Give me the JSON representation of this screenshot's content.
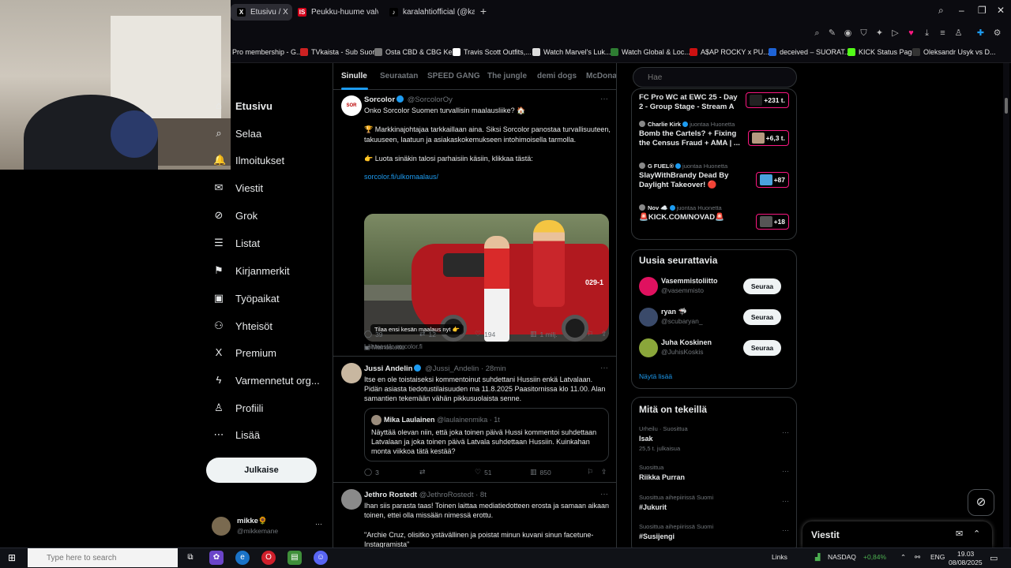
{
  "browser": {
    "tabs": [
      {
        "label": "Etusivu / X",
        "fav_color": "#000000",
        "fav": "X"
      },
      {
        "label": "Peukku-huume valvottaa",
        "fav_color": "#d0021b",
        "fav": "IS"
      },
      {
        "label": "karalahtiofficial (@karalahti...",
        "fav_color": "#000000",
        "fav": "♪"
      }
    ],
    "bookmarks": [
      {
        "label": "Pro membership - G...",
        "color": "#444444"
      },
      {
        "label": "TVkaista - Sub Suora",
        "color": "#cc2222"
      },
      {
        "label": "Osta CBD & CBG Ke...",
        "color": "#777777"
      },
      {
        "label": "Travis Scott Outfits,...",
        "color": "#ffffff"
      },
      {
        "label": "Watch Marvel's Luk...",
        "color": "#dddddd"
      },
      {
        "label": "Watch Global & Loc...",
        "color": "#2e7d32"
      },
      {
        "label": "A$AP ROCKY x PU...",
        "color": "#cc1111"
      },
      {
        "label": "deceived – SUORAT...",
        "color": "#1e63d6"
      },
      {
        "label": "KICK Status Page",
        "color": "#53fc18"
      },
      {
        "label": "Oleksandr Usyk vs D...",
        "color": "#333333"
      }
    ]
  },
  "nav": {
    "items": [
      {
        "label": "Etusivu",
        "icon": "⌂",
        "bold": true
      },
      {
        "label": "Selaa",
        "icon": "⌕"
      },
      {
        "label": "Ilmoitukset",
        "icon": "🔔"
      },
      {
        "label": "Viestit",
        "icon": "✉"
      },
      {
        "label": "Grok",
        "icon": "⊘"
      },
      {
        "label": "Listat",
        "icon": "☰"
      },
      {
        "label": "Kirjanmerkit",
        "icon": "⚑"
      },
      {
        "label": "Työpaikat",
        "icon": "▣"
      },
      {
        "label": "Yhteisöt",
        "icon": "⚇"
      },
      {
        "label": "Premium",
        "icon": "X"
      },
      {
        "label": "Varmennetut org...",
        "icon": "ϟ"
      },
      {
        "label": "Profiili",
        "icon": "♙"
      },
      {
        "label": "Lisää",
        "icon": "⋯"
      }
    ],
    "post_label": "Julkaise",
    "profile": {
      "name": "mikke🌻",
      "handle": "@mikkemane",
      "more": "···"
    }
  },
  "feed": {
    "tabs": [
      "Sinulle",
      "Seuraatan",
      "SPEED GANG",
      "The jungle",
      "demi dogs",
      "McDonal"
    ],
    "tweets": [
      {
        "name": "Sorcolor",
        "handle": "@SorcolorOy",
        "text": "Onko Sorcolor Suomen turvallisin maalausliike? 🏠\n\n🏆 Markkinajohtajaa tarkkaillaan aina. Siksi Sorcolor panostaa turvallisuuteen, takuuseen, laatuun ja asiakaskokemukseen intohimoisella tarmolla.\n\n👉 Luota sinäkin talosi parhaisiin käsiin, klikkaa tästä:",
        "link": "sorcolor.fi/ulkomaalaus/",
        "media_caption": "Tilaa ensi kesän maalaus nyt 👉",
        "media_plate": "029-1",
        "media_source": "Lähteestä: sorcolor.fi",
        "promoted": "Mainostettu",
        "replies": "39",
        "reposts": "12",
        "likes": "194",
        "views": "1 milj."
      },
      {
        "name": "Jussi Andelin",
        "handle": "@Jussi_Andelin · 28min",
        "text": "Itse en ole toistaiseksi kommentoinut suhdettani Hussiin enkä Latvalaan. Pidän asiasta tiedotustilaisuuden ma 11.8.2025 Paasitornissa klo 11.00. Alan samantien tekemään vähän pikkusuolaista senne.",
        "quote": {
          "name": "Mika Laulainen",
          "handle": "@laulainenmika · 1t",
          "text": "Näyttää olevan niin, että joka toinen päivä Hussi kommentoi suhdettaan Latvalaan ja joka toinen päivä Latvala suhdettaan Hussiin. Kuinkahan monta viikkoa tätä kestää?"
        },
        "replies": "3",
        "reposts": "",
        "likes": "51",
        "views": "850"
      },
      {
        "name": "Jethro Rostedt",
        "handle": "@JethroRostedt · 8t",
        "text": "Ihan siis parasta taas! Toinen laittaa mediatiedotteen erosta ja samaan aikaan toinen, ettei olla missään nimessä erottu.\n\n\"Archie Cruz, olisitko ystävällinen ja poistat minun kuvani sinun facetune-Instagramista\""
      }
    ]
  },
  "right": {
    "search_placeholder": "Hae",
    "live": [
      {
        "who": "",
        "suffix": "",
        "title": "FC Pro WC at EWC 25 - Day 2 - Group Stage - Stream A",
        "count": "+231 t.",
        "thumb": "#222222"
      },
      {
        "who": "Charlie Kirk",
        "suffix": "juontaa Huonetta",
        "title": "Bomb the Cartels? + Fixing the Census Fraud + AMA | ...",
        "count": "+6,3 t.",
        "thumb": "#b59a80"
      },
      {
        "who": "G FUEL®",
        "suffix": "juontaa Huonetta",
        "title": "SlayWithBrandy Dead By Daylight Takeover! 🔴",
        "count": "+87",
        "thumb": "#4aa3df"
      },
      {
        "who": "Nov ☁️",
        "suffix": "juontaa Huonetta",
        "title": "🚨KICK.COM/NOVAD🚨",
        "count": "+18",
        "thumb": "#555555"
      }
    ],
    "follow_title": "Uusia seurattavia",
    "follow": [
      {
        "name": "Vasemmistoliitto",
        "handle": "@vasemmisto",
        "btn": "Seuraa",
        "color": "#e0115f"
      },
      {
        "name": "ryan 🦈",
        "handle": "@scubaryan_",
        "btn": "Seuraa",
        "color": "#3a4a6a"
      },
      {
        "name": "Juha Koskinen",
        "handle": "@JuhisKoskis",
        "btn": "Seuraa",
        "color": "#8aa63a"
      }
    ],
    "show_more": "Näytä lisää",
    "trends_title": "Mitä on tekeillä",
    "trends": [
      {
        "cat": "Urheilu · Suosittua",
        "title": "Isak",
        "sub": "25,5 t. julkaisua"
      },
      {
        "cat": "Suosittua",
        "title": "Riikka Purran",
        "sub": ""
      },
      {
        "cat": "Suosittua aihepiirissä Suomi",
        "title": "#Jukurit",
        "sub": ""
      },
      {
        "cat": "Suosittua aihepiirissä Suomi",
        "title": "#Susijengi",
        "sub": ""
      }
    ],
    "messages_label": "Viestit"
  },
  "taskbar": {
    "search_placeholder": "Type here to search",
    "links_label": "Links",
    "ticker_name": "NASDAQ",
    "ticker_value": "+0,84%",
    "lang": "ENG",
    "time": "19.03",
    "date": "08/08/2025"
  }
}
